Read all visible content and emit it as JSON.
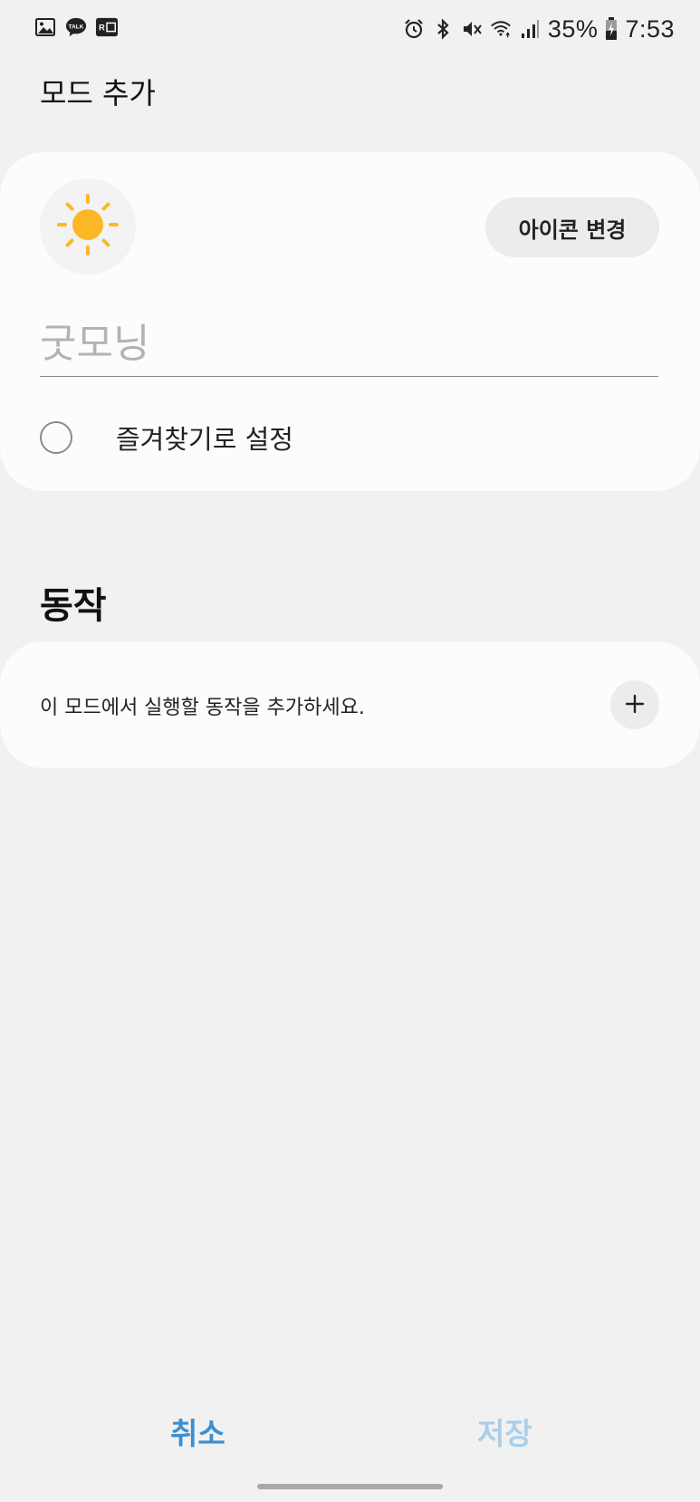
{
  "status_bar": {
    "left_icons": [
      "gallery-icon",
      "kakaotalk-icon",
      "rdm-icon"
    ],
    "kakaotalk_icon_text": "TALK",
    "right_icons": [
      "alarm-icon",
      "bluetooth-icon",
      "vibrate-mute-icon",
      "wifi-icon",
      "signal-icon"
    ],
    "battery_percent": "35%",
    "time": "7:53"
  },
  "header": {
    "title": "모드 추가"
  },
  "mode_card": {
    "icon": "sun-icon",
    "icon_color": "#fbb826",
    "change_icon_label": "아이콘 변경",
    "name_value": "",
    "name_placeholder": "굿모닝",
    "favorite_label": "즐겨찾기로 설정"
  },
  "actions": {
    "heading": "동작",
    "hint": "이 모드에서 실행할 동작을 추가하세요.",
    "add_icon": "plus-icon"
  },
  "footer": {
    "cancel_label": "취소",
    "save_label": "저장",
    "cancel_color": "#3b8fd0",
    "save_color": "#a9cfea"
  }
}
